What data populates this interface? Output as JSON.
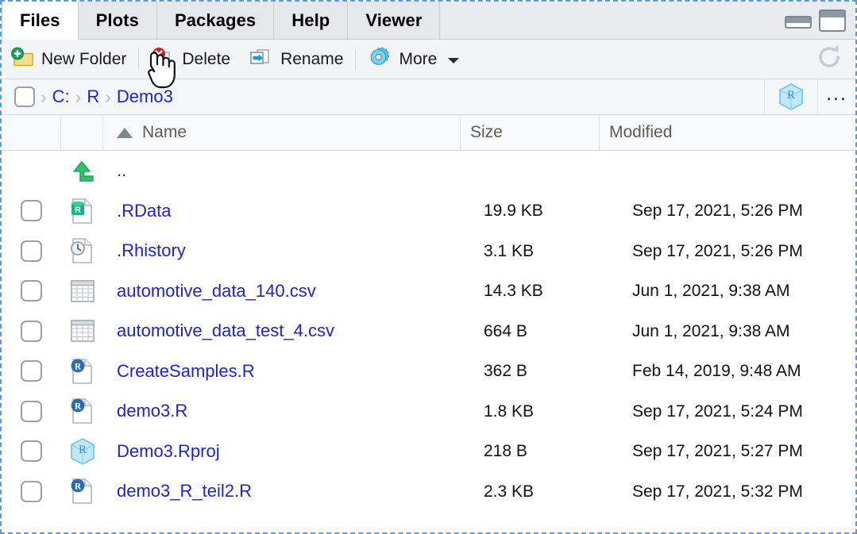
{
  "window": {
    "minimize_label": "minimize",
    "maximize_label": "maximize"
  },
  "tabs": [
    {
      "label": "Files",
      "active": true
    },
    {
      "label": "Plots",
      "active": false
    },
    {
      "label": "Packages",
      "active": false
    },
    {
      "label": "Help",
      "active": false
    },
    {
      "label": "Viewer",
      "active": false
    }
  ],
  "toolbar": {
    "new_folder_label": "New Folder",
    "delete_label": "Delete",
    "rename_label": "Rename",
    "more_label": "More",
    "refresh_icon": "refresh-icon"
  },
  "breadcrumb": {
    "home_icon": "home-drive-icon",
    "separator": "›",
    "items": [
      "C:",
      "R",
      "Demo3"
    ],
    "project_badge_icon": "rproject-cube-icon",
    "overflow_label": "..."
  },
  "columns": {
    "name": "Name",
    "size": "Size",
    "modified": "Modified",
    "sort_by": "Name",
    "sort_direction": "ascending"
  },
  "files": [
    {
      "name": "..",
      "icon": "up-arrow-icon",
      "size": "",
      "modified": "",
      "has_checkbox": false
    },
    {
      "name": ".RData",
      "icon": "rdata-file-icon",
      "size": "19.9 KB",
      "modified": "Sep 17, 2021, 5:26 PM",
      "has_checkbox": true
    },
    {
      "name": ".Rhistory",
      "icon": "rhistory-file-icon",
      "size": "3.1 KB",
      "modified": "Sep 17, 2021, 5:26 PM",
      "has_checkbox": true
    },
    {
      "name": "automotive_data_140.csv",
      "icon": "csv-file-icon",
      "size": "14.3 KB",
      "modified": "Jun 1, 2021, 9:38 AM",
      "has_checkbox": true
    },
    {
      "name": "automotive_data_test_4.csv",
      "icon": "csv-file-icon",
      "size": "664 B",
      "modified": "Jun 1, 2021, 9:38 AM",
      "has_checkbox": true
    },
    {
      "name": "CreateSamples.R",
      "icon": "rscript-file-icon",
      "size": "362 B",
      "modified": "Feb 14, 2019, 9:48 AM",
      "has_checkbox": true
    },
    {
      "name": "demo3.R",
      "icon": "rscript-file-icon",
      "size": "1.8 KB",
      "modified": "Sep 17, 2021, 5:24 PM",
      "has_checkbox": true
    },
    {
      "name": "Demo3.Rproj",
      "icon": "rproject-cube-icon",
      "size": "218 B",
      "modified": "Sep 17, 2021, 5:27 PM",
      "has_checkbox": true
    },
    {
      "name": "demo3_R_teil2.R",
      "icon": "rscript-file-icon",
      "size": "2.3 KB",
      "modified": "Sep 17, 2021, 5:32 PM",
      "has_checkbox": true
    }
  ],
  "cursor": {
    "type": "pointing-hand"
  },
  "colors": {
    "link": "#2222cc",
    "tab_active_bg": "#ffffff",
    "tab_bg": "#e4e8ea",
    "focus_border": "#5b9bd5",
    "header_text": "#5c5c52"
  }
}
